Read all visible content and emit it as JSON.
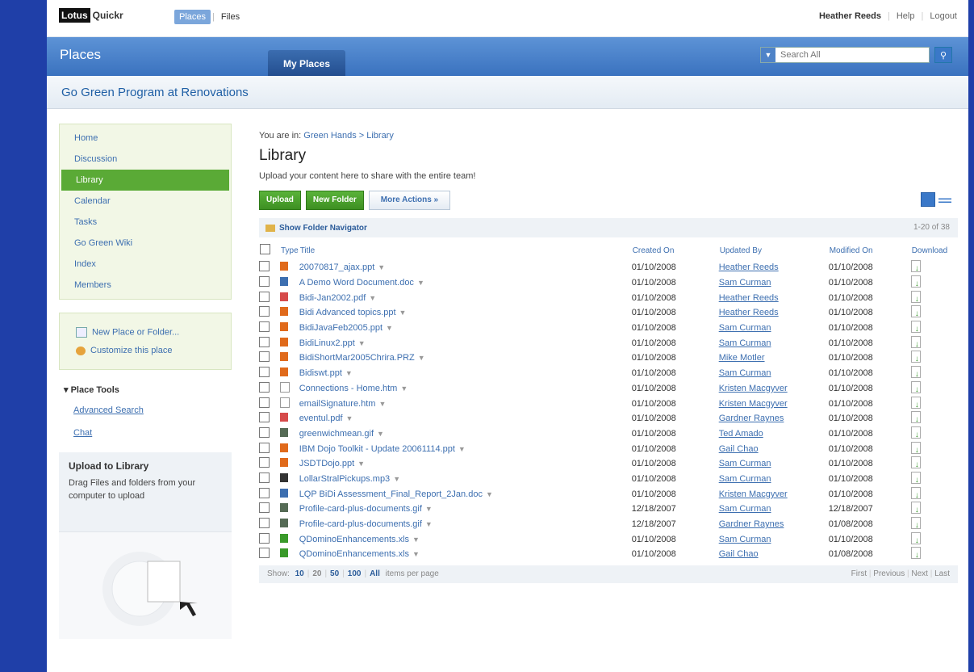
{
  "topbar": {
    "logo_box": "Lotus",
    "logo_text": "Quickr",
    "tab_places": "Places",
    "tab_files": "Files",
    "user": "Heather Reeds",
    "help": "Help",
    "logout": "Logout"
  },
  "band": {
    "title": "Places",
    "tab": "My Places",
    "search_placeholder": "Search All"
  },
  "place": {
    "title": "Go Green Program at Renovations"
  },
  "sidebar": {
    "nav": [
      "Home",
      "Discussion",
      "Library",
      "Calendar",
      "Tasks",
      "Go Green Wiki",
      "Index",
      "Members"
    ],
    "new_place": "New Place or Folder...",
    "customize": "Customize this place",
    "tools_title": "Place Tools",
    "tools": [
      "Advanced Search",
      "Chat"
    ],
    "upload_title": "Upload to Library",
    "upload_desc": "Drag Files and folders from your computer to upload"
  },
  "main": {
    "crumb_prefix": "You are in:",
    "crumb": "Green Hands > Library",
    "title": "Library",
    "intro": "Upload your content here to share with the entire team!",
    "btn_upload": "Upload",
    "btn_newfolder": "New Folder",
    "btn_more": "More Actions »",
    "folder_nav": "Show Folder Navigator",
    "count": "1-20 of 38",
    "headers": {
      "type": "Type",
      "title": "Title",
      "created": "Created On",
      "updated": "Updated By",
      "modified": "Modified On",
      "download": "Download"
    },
    "rows": [
      {
        "title": "20070817_ajax.ppt",
        "type": "ppt",
        "created": "01/10/2008",
        "by": "Heather Reeds",
        "modified": "01/10/2008"
      },
      {
        "title": "A Demo Word Document.doc",
        "type": "doc",
        "created": "01/10/2008",
        "by": "Sam Curman",
        "modified": "01/10/2008"
      },
      {
        "title": "Bidi-Jan2002.pdf",
        "type": "pdf",
        "created": "01/10/2008",
        "by": "Heather Reeds",
        "modified": "01/10/2008"
      },
      {
        "title": "Bidi Advanced topics.ppt",
        "type": "ppt",
        "created": "01/10/2008",
        "by": "Heather Reeds",
        "modified": "01/10/2008"
      },
      {
        "title": "BidiJavaFeb2005.ppt",
        "type": "ppt",
        "created": "01/10/2008",
        "by": "Sam Curman",
        "modified": "01/10/2008"
      },
      {
        "title": "BidiLinux2.ppt",
        "type": "ppt",
        "created": "01/10/2008",
        "by": "Sam Curman",
        "modified": "01/10/2008"
      },
      {
        "title": "BidiShortMar2005Chrira.PRZ",
        "type": "ppt",
        "created": "01/10/2008",
        "by": "Mike Motler",
        "modified": "01/10/2008"
      },
      {
        "title": "Bidiswt.ppt",
        "type": "ppt",
        "created": "01/10/2008",
        "by": "Sam Curman",
        "modified": "01/10/2008"
      },
      {
        "title": "Connections - Home.htm",
        "type": "htm",
        "created": "01/10/2008",
        "by": "Kristen Macgyver",
        "modified": "01/10/2008"
      },
      {
        "title": "emailSignature.htm",
        "type": "htm",
        "created": "01/10/2008",
        "by": "Kristen Macgyver",
        "modified": "01/10/2008"
      },
      {
        "title": "eventul.pdf",
        "type": "pdf",
        "created": "01/10/2008",
        "by": "Gardner Raynes",
        "modified": "01/10/2008"
      },
      {
        "title": "greenwichmean.gif",
        "type": "gif",
        "created": "01/10/2008",
        "by": "Ted Amado",
        "modified": "01/10/2008"
      },
      {
        "title": "IBM Dojo Toolkit - Update 20061114.ppt",
        "type": "ppt",
        "created": "01/10/2008",
        "by": "Gail Chao",
        "modified": "01/10/2008"
      },
      {
        "title": "JSDTDojo.ppt",
        "type": "ppt",
        "created": "01/10/2008",
        "by": "Sam Curman",
        "modified": "01/10/2008"
      },
      {
        "title": "LollarStralPickups.mp3",
        "type": "mp3",
        "created": "01/10/2008",
        "by": "Sam Curman",
        "modified": "01/10/2008"
      },
      {
        "title": "LQP BiDi Assessment_Final_Report_2Jan.doc",
        "type": "doc",
        "created": "01/10/2008",
        "by": "Kristen Macgyver",
        "modified": "01/10/2008"
      },
      {
        "title": "Profile-card-plus-documents.gif",
        "type": "gif",
        "created": "12/18/2007",
        "by": "Sam Curman",
        "modified": "12/18/2007"
      },
      {
        "title": "Profile-card-plus-documents.gif",
        "type": "gif",
        "created": "12/18/2007",
        "by": "Gardner Raynes",
        "modified": "01/08/2008"
      },
      {
        "title": "QDominoEnhancements.xls",
        "type": "xls",
        "created": "01/10/2008",
        "by": "Sam Curman",
        "modified": "01/10/2008"
      },
      {
        "title": "QDominoEnhancements.xls",
        "type": "xls",
        "created": "01/10/2008",
        "by": "Gail Chao",
        "modified": "01/08/2008"
      }
    ],
    "footer": {
      "show": "Show:",
      "sizes": [
        "10",
        "20",
        "50",
        "100",
        "All"
      ],
      "suffix": "items per page",
      "first": "First",
      "previous": "Previous",
      "next": "Next",
      "last": "Last"
    }
  },
  "colors": {
    "ppt": "#e06a1b",
    "doc": "#3d6fb0",
    "pdf": "#d64a4a",
    "htm": "#ffffff",
    "gif": "#556b55",
    "mp3": "#333333",
    "xls": "#3a9a2a"
  }
}
